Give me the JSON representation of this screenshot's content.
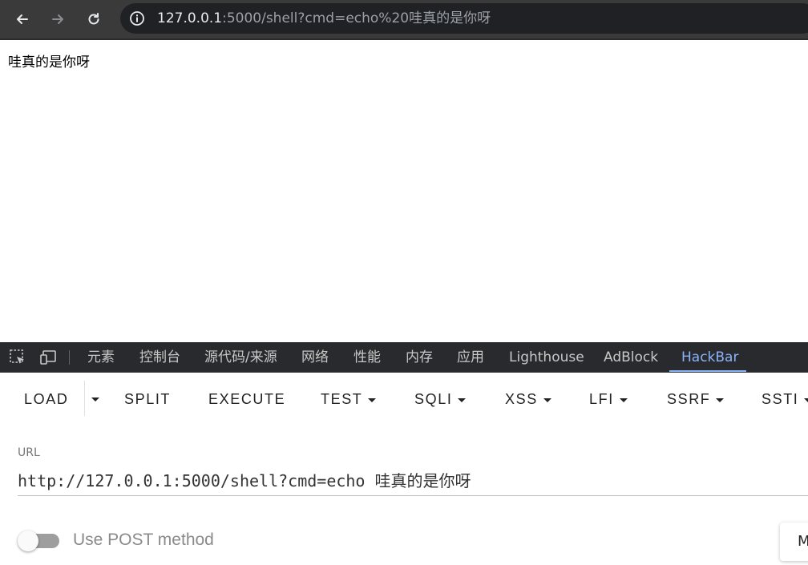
{
  "browser": {
    "url_host": "127.0.0.1",
    "url_rest": ":5000/shell?cmd=echo%20哇真的是你呀"
  },
  "page": {
    "output_text": "哇真的是你呀"
  },
  "devtools": {
    "tabs": [
      {
        "label": "元素"
      },
      {
        "label": "控制台"
      },
      {
        "label": "源代码/来源"
      },
      {
        "label": "网络"
      },
      {
        "label": "性能"
      },
      {
        "label": "内存"
      },
      {
        "label": "应用"
      },
      {
        "label": "Lighthouse"
      },
      {
        "label": "AdBlock"
      },
      {
        "label": "HackBar"
      }
    ],
    "active_tab": "HackBar",
    "active_color": "#8ab4f8"
  },
  "hackbar": {
    "buttons": {
      "load": "LOAD",
      "split": "SPLIT",
      "execute": "EXECUTE",
      "test": "TEST",
      "sqli": "SQLI",
      "xss": "XSS",
      "lfi": "LFI",
      "ssrf": "SSRF",
      "ssti": "SSTI"
    },
    "url_label": "URL",
    "url_value": "http://127.0.0.1:5000/shell?cmd=echo 哇真的是你呀",
    "post_toggle_label": "Use POST method",
    "post_enabled": false,
    "modify_button_label": "M"
  }
}
